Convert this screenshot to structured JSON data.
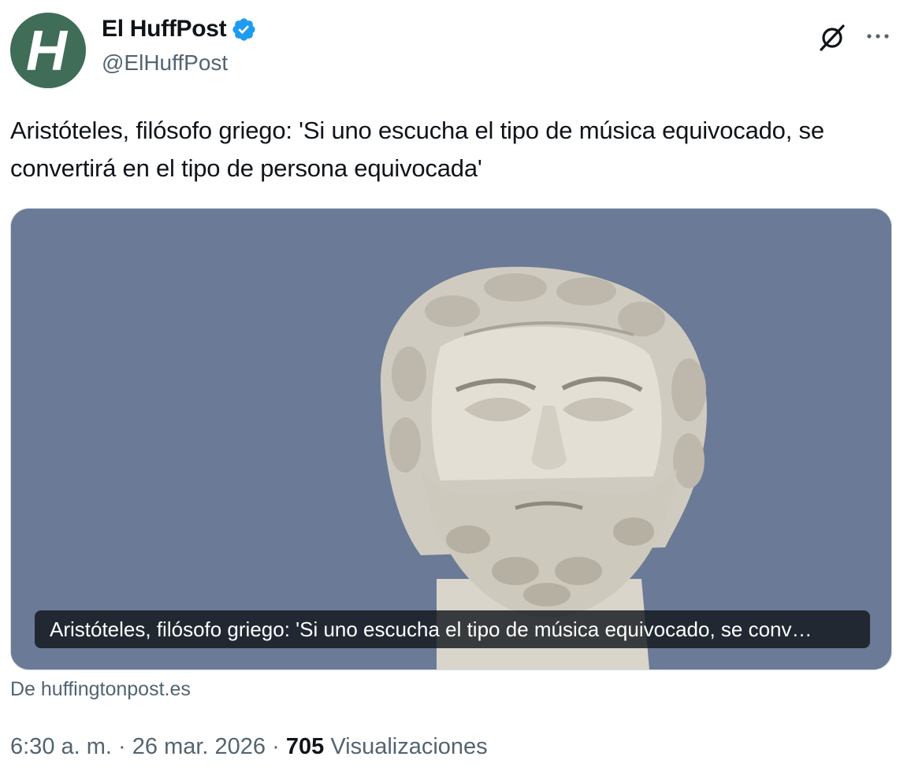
{
  "author": {
    "display_name": "El HuffPost",
    "handle": "@ElHuffPost",
    "avatar_letter": "H",
    "avatar_color": "#3f6d58",
    "verified_color": "#1d9bf0"
  },
  "tweet": {
    "text": "Aristóteles, filósofo griego: 'Si uno escucha el tipo de música equivocado, se convertirá en el tipo de persona equivocada'"
  },
  "card": {
    "caption": "Aristóteles, filósofo griego: 'Si uno escucha el tipo de música equivocado, se conv…",
    "source": "De huffingtonpost.es"
  },
  "meta": {
    "time": "6:30 a. m.",
    "separator": "·",
    "date": "26 mar. 2026",
    "views_count": "705",
    "views_label": "Visualizaciones"
  },
  "icons": {
    "grok": "grok-icon",
    "more": "more-icon",
    "verified": "verified-badge-icon"
  }
}
